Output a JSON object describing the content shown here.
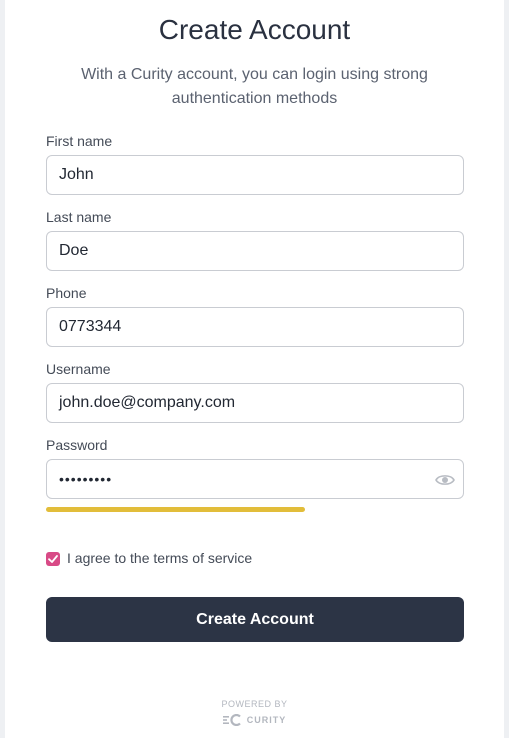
{
  "page": {
    "title": "Create Account",
    "subtitle": "With a Curity account, you can login using strong authentication methods"
  },
  "fields": {
    "first_name": {
      "label": "First name",
      "value": "John"
    },
    "last_name": {
      "label": "Last name",
      "value": "Doe"
    },
    "phone": {
      "label": "Phone",
      "value": "0773344"
    },
    "username": {
      "label": "Username",
      "value": "john.doe@company.com"
    },
    "password": {
      "label": "Password",
      "value": "•••••••••"
    }
  },
  "password_strength": {
    "level": 0.62,
    "color": "#e2bd3a"
  },
  "terms": {
    "label": "I agree to the terms of service",
    "checked": true
  },
  "submit": {
    "label": "Create Account"
  },
  "footer": {
    "powered_by": "POWERED BY",
    "brand": "CURITY"
  },
  "colors": {
    "accent": "#d84a86",
    "button": "#2c3445"
  },
  "icons": {
    "password_toggle": "eye-icon",
    "brand_logo": "curity-logo-icon"
  }
}
